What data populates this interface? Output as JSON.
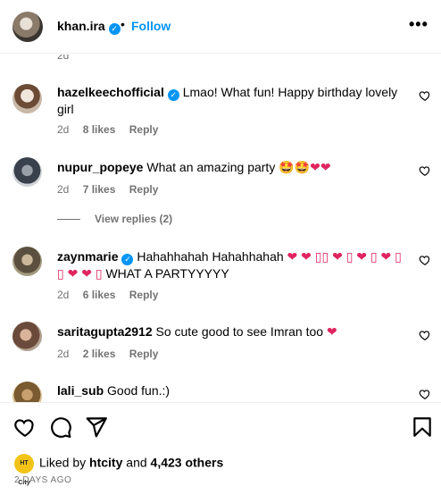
{
  "header": {
    "username": "khan.ira",
    "dot": "•",
    "follow_label": "Follow",
    "more_label": "•••"
  },
  "top_cut_meta": "2d",
  "comments": [
    {
      "user": "hazelkeechofficial",
      "verified": true,
      "text_line1": "Lmao! What fun! Happy birthday lovely",
      "text_line2": "girl",
      "time": "2d",
      "likes": "8 likes",
      "reply": "Reply"
    },
    {
      "user": "nupur_popeye",
      "verified": false,
      "text": "What an amazing party",
      "emojis": [
        "🤩",
        "🤩",
        "❤",
        "❤"
      ],
      "time": "2d",
      "likes": "7 likes",
      "reply": "Reply"
    },
    {
      "user": "zaynmarie",
      "verified": true,
      "text_line1": "Hahahhahah Hahahhahah",
      "emojis_line1": "❤ ❤ ▯▯ ❤ ▯ ❤ ▯ ❤ ▯",
      "emojis_line2": "▯ ❤ ❤ ▯",
      "text_line2": "WHAT A PARTYYYYY",
      "time": "2d",
      "likes": "6 likes",
      "reply": "Reply"
    },
    {
      "user": "saritagupta2912",
      "verified": false,
      "text": "So cute good to see Imran too",
      "emoji": "❤",
      "time": "2d",
      "likes": "2 likes",
      "reply": "Reply"
    },
    {
      "user": "lali_sub",
      "verified": false,
      "text": "Good fun.:)"
    }
  ],
  "view_replies": "View replies (2)",
  "liked_by": {
    "logo_text": "HT City",
    "prefix": "Liked by",
    "user": "htcity",
    "and": "and",
    "count": "4,423 others"
  },
  "post_time": "2 DAYS AGO",
  "icons": {
    "like": "heart-icon",
    "comment": "comment-icon",
    "share": "share-icon",
    "save": "bookmark-icon"
  },
  "colors": {
    "link_blue": "#0095f6",
    "meta_gray": "#737373",
    "heart_red": "#e0245e"
  }
}
